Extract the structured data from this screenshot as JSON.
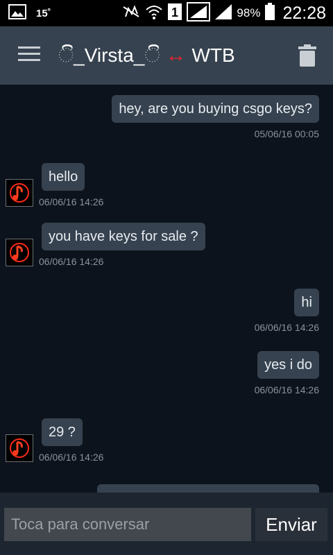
{
  "status_bar": {
    "temperature": "15˚",
    "battery_percent": "98%",
    "time": "22:28",
    "sim_slot": "1",
    "icons": [
      "image-icon",
      "mute-nfc-icon",
      "wifi-icon",
      "sim-icon",
      "signal-icon",
      "signal-icon-2",
      "battery-icon"
    ]
  },
  "app_bar": {
    "name_left": "ි_Virsta_ි",
    "arrow": "↔",
    "name_right": "WTB",
    "icons": [
      "hamburger-menu-icon",
      "trash-icon"
    ]
  },
  "messages": [
    {
      "side": "sent",
      "text": "hey, are you buying csgo keys?",
      "timestamp": "05/06/16 00:05"
    },
    {
      "side": "received",
      "text": "hello",
      "timestamp": "06/06/16 14:26"
    },
    {
      "side": "received",
      "text": "you have keys for sale ?",
      "timestamp": "06/06/16 14:26"
    },
    {
      "side": "sent",
      "text": "hi",
      "timestamp": "06/06/16 14:26"
    },
    {
      "side": "sent",
      "text": "yes i do",
      "timestamp": "06/06/16 14:26"
    },
    {
      "side": "received",
      "text": "29 ?",
      "timestamp": "06/06/16 14:26"
    },
    {
      "side": "sent",
      "text": "",
      "timestamp": ""
    }
  ],
  "composer": {
    "placeholder": "Toca para conversar",
    "send_label": "Enviar"
  },
  "colors": {
    "background": "#0d131c",
    "app_bar": "#36424f",
    "bubble": "#36424f",
    "accent_arrow": "#e0282b"
  }
}
